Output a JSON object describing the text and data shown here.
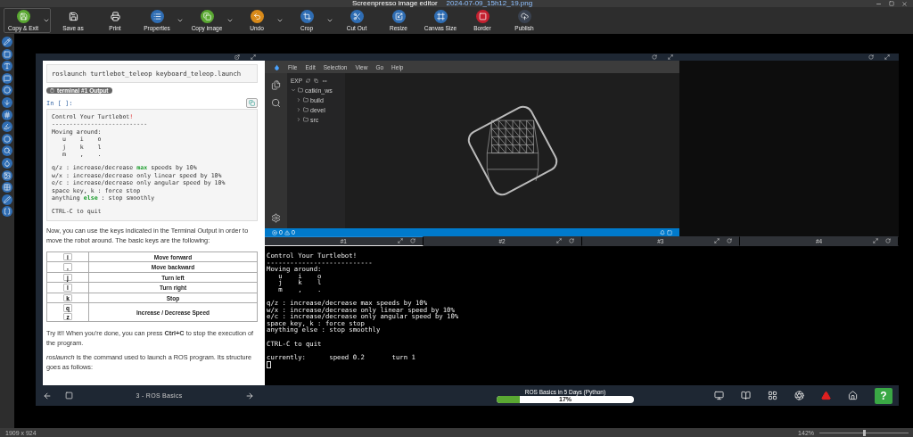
{
  "window": {
    "title": "Screenpresso image editor",
    "file": "2024-07-09_15h12_19.png"
  },
  "toolbar": [
    {
      "label": "Copy & Exit",
      "color": "#5aa832",
      "dropdown": true,
      "selected": true
    },
    {
      "label": "Save as",
      "dropdown": false,
      "selected": false
    },
    {
      "label": "Print",
      "dropdown": false,
      "selected": false
    },
    {
      "label": "Properties",
      "color": "#2f6db3",
      "dropdown": true,
      "selected": false
    },
    {
      "label": "Copy image",
      "color": "#5aa832",
      "dropdown": true,
      "selected": false
    },
    {
      "label": "Undo",
      "color": "#d88a1a",
      "dropdown": true,
      "selected": false
    },
    {
      "label": "Crop",
      "color": "#2f6db3",
      "dropdown": true,
      "selected": false
    },
    {
      "label": "Cut Out",
      "color": "#2f6db3",
      "dropdown": false,
      "selected": false
    },
    {
      "label": "Resize",
      "color": "#2f6db3",
      "dropdown": false,
      "selected": false
    },
    {
      "label": "Canvas Size",
      "color": "#2f6db3",
      "dropdown": false,
      "selected": false
    },
    {
      "label": "Border",
      "color": "#c4202f",
      "dropdown": false,
      "selected": false
    },
    {
      "label": "Publish",
      "color": "#3a4250",
      "dropdown": false,
      "selected": false
    }
  ],
  "notebook": {
    "command": "roslaunch turtlebot_teleop keyboard_teleop.launch",
    "output_badge": "terminal #1 Output",
    "prompt": "In [ ]:",
    "output": [
      [
        [
          {
            "t": "Control Your Turtlebot"
          },
          {
            "t": "!",
            "kind": "error"
          }
        ],
        [
          {
            "t": "---------------------------"
          }
        ],
        [
          {
            "t": "Moving around:"
          }
        ],
        [
          {
            "t": "   u    i    o"
          }
        ],
        [
          {
            "t": "   j    k    l"
          }
        ],
        [
          {
            "t": "   m    ,    ."
          }
        ]
      ],
      [
        [
          {
            "t": "q/z : increase/decrease "
          },
          {
            "t": "max",
            "kind": "keyword"
          },
          {
            "t": " speeds by 10%"
          }
        ],
        [
          {
            "t": "w/x : increase/decrease only linear speed by 10%"
          }
        ],
        [
          {
            "t": "e/c : increase/decrease only angular speed by 10%"
          }
        ],
        [
          {
            "t": "space key, k : force stop"
          }
        ],
        [
          {
            "t": "anything "
          },
          {
            "t": "else",
            "kind": "keyword"
          },
          {
            "t": " : stop smoothly"
          }
        ]
      ],
      [
        [
          {
            "t": "CTRL-C to quit"
          }
        ]
      ]
    ],
    "intro": "Now, you can use the keys indicated in the Terminal Output in order to move the robot around. The basic keys are the following:",
    "key_table": [
      {
        "keys": [
          "i"
        ],
        "action": "Move forward"
      },
      {
        "keys": [
          ","
        ],
        "action": "Move backward"
      },
      {
        "keys": [
          "j"
        ],
        "action": "Turn left"
      },
      {
        "keys": [
          "l"
        ],
        "action": "Turn right"
      },
      {
        "keys": [
          "k"
        ],
        "action": "Stop"
      },
      {
        "keys": [
          "q",
          "z"
        ],
        "action": "Increase / Decrease Speed"
      }
    ],
    "paragraphs": [
      "Try it!! When you're done, you can press **Ctrl+C** to stop the execution of the program.",
      "*roslaunch* is the command used to launch a ROS program. Its structure goes as follows:"
    ]
  },
  "vscode": {
    "menu": [
      "File",
      "Edit",
      "Selection",
      "View",
      "Go",
      "Help"
    ],
    "explorer_title": "EXP",
    "tree": [
      {
        "label": "catkin_ws",
        "expanded": true,
        "children": [
          {
            "label": "build",
            "expanded": false
          },
          {
            "label": "devel",
            "expanded": false
          },
          {
            "label": "src",
            "expanded": false
          }
        ]
      }
    ],
    "errors": "0",
    "warnings": "0"
  },
  "terminal_tabs": [
    {
      "label": "#1",
      "selected": true
    },
    {
      "label": "#2",
      "selected": false
    },
    {
      "label": "#3",
      "selected": false
    },
    {
      "label": "#4",
      "selected": false
    }
  ],
  "terminal": [
    [
      "Control Your Turtlebot!",
      "---------------------------",
      "Moving around:",
      "   u    i    o",
      "   j    k    l",
      "   m    ,    ."
    ],
    [
      "q/z : increase/decrease max speeds by 10%",
      "w/x : increase/decrease only linear speed by 10%",
      "e/c : increase/decrease only angular speed by 10%",
      "space key, k : force stop",
      "anything else : stop smoothly"
    ],
    [
      "CTRL-C to quit"
    ],
    [
      "currently:      speed 0.2       turn 1"
    ]
  ],
  "bottom_nav": {
    "chapter": "3 - ROS Basics",
    "course": "ROS Basics in 5 Days (Python)",
    "progress": {
      "level": 0.17,
      "reading": "17%"
    },
    "help": "?"
  },
  "status_bar": {
    "dimensions": "1909 x 924",
    "zoom": "142%",
    "zoom_slider": {
      "level": 0.49
    }
  }
}
